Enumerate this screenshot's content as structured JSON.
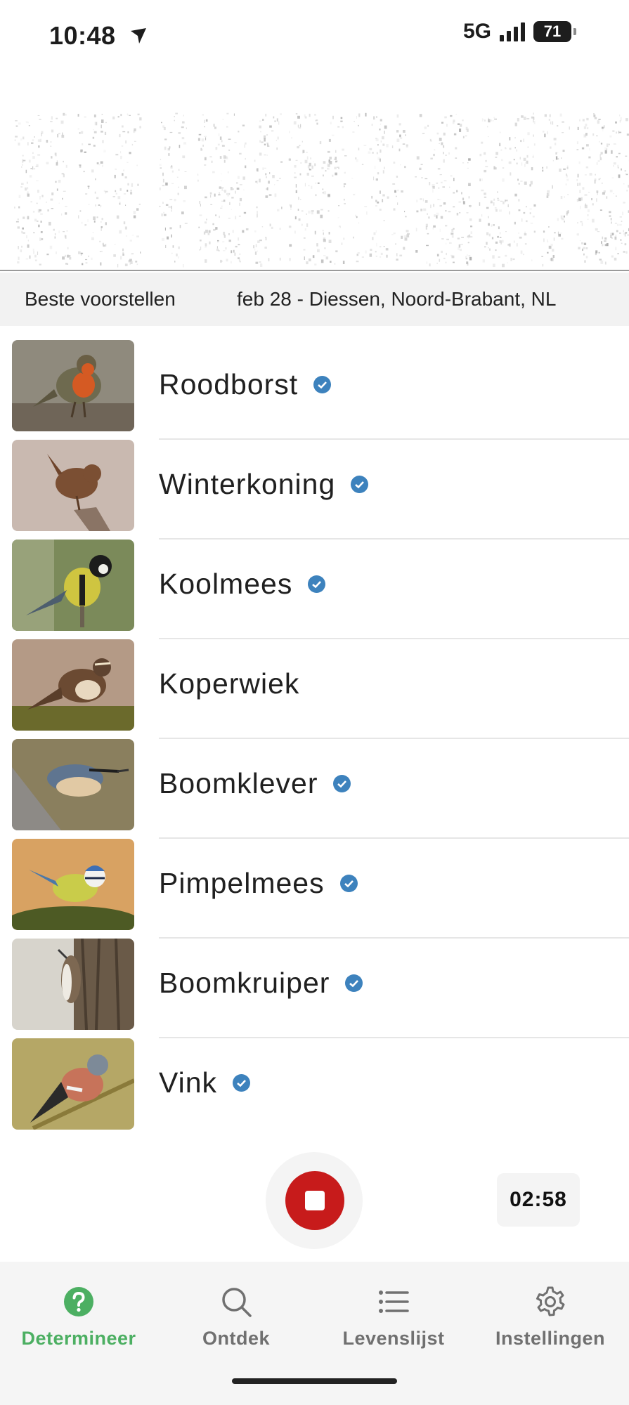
{
  "status_bar": {
    "time": "10:48",
    "network": "5G",
    "battery": "71"
  },
  "subheader": {
    "best_label": "Beste voorstellen",
    "location": "feb 28 - Diessen, Noord-Brabant, NL"
  },
  "species": [
    {
      "name": "Roodborst",
      "verified": true
    },
    {
      "name": "Winterkoning",
      "verified": true
    },
    {
      "name": "Koolmees",
      "verified": true
    },
    {
      "name": "Koperwiek",
      "verified": false
    },
    {
      "name": "Boomklever",
      "verified": true
    },
    {
      "name": "Pimpelmees",
      "verified": true
    },
    {
      "name": "Boomkruiper",
      "verified": true
    },
    {
      "name": "Vink",
      "verified": true
    }
  ],
  "recorder": {
    "timer": "02:58"
  },
  "nav": [
    {
      "label": "Determineer",
      "icon": "question-circle-icon",
      "active": true
    },
    {
      "label": "Ontdek",
      "icon": "search-icon",
      "active": false
    },
    {
      "label": "Levenslijst",
      "icon": "list-icon",
      "active": false
    },
    {
      "label": "Instellingen",
      "icon": "gear-icon",
      "active": false
    }
  ],
  "colors": {
    "accent": "#4caf62",
    "record": "#c71b1b",
    "verified": "#3d82bd"
  }
}
